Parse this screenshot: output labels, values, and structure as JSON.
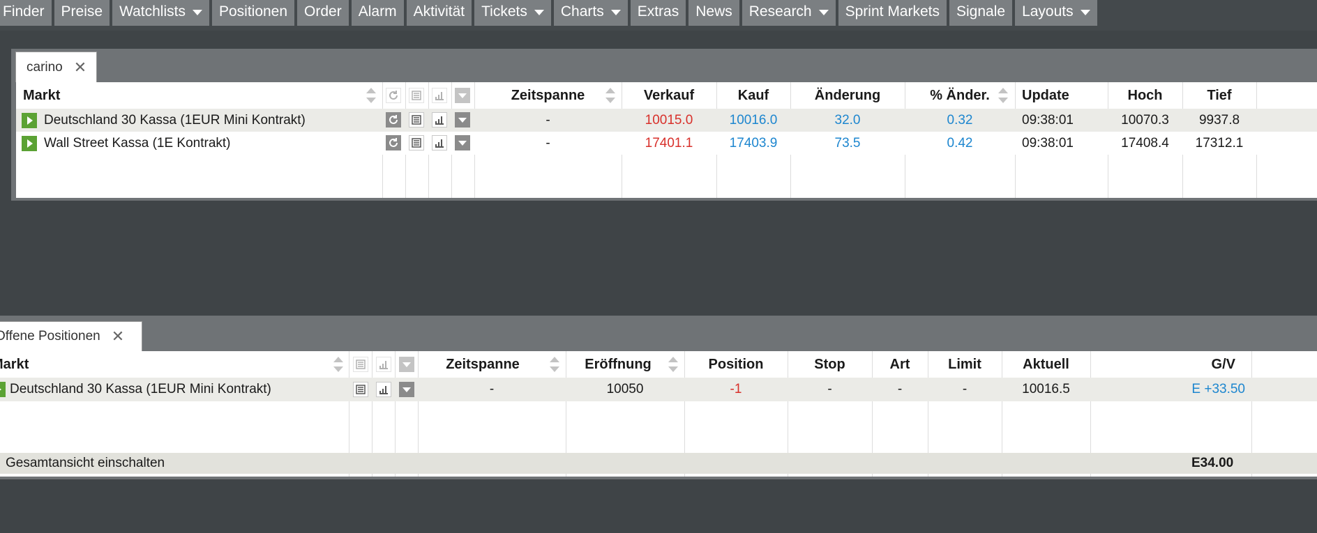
{
  "menu": [
    {
      "label": "Finder",
      "dropdown": false
    },
    {
      "label": "Preise",
      "dropdown": false
    },
    {
      "label": "Watchlists",
      "dropdown": true
    },
    {
      "label": "Positionen",
      "dropdown": false
    },
    {
      "label": "Order",
      "dropdown": false
    },
    {
      "label": "Alarm",
      "dropdown": false
    },
    {
      "label": "Aktivität",
      "dropdown": false
    },
    {
      "label": "Tickets",
      "dropdown": true
    },
    {
      "label": "Charts",
      "dropdown": true
    },
    {
      "label": "Extras",
      "dropdown": false
    },
    {
      "label": "News",
      "dropdown": false
    },
    {
      "label": "Research",
      "dropdown": true
    },
    {
      "label": "Sprint Markets",
      "dropdown": false
    },
    {
      "label": "Signale",
      "dropdown": false
    },
    {
      "label": "Layouts",
      "dropdown": true
    }
  ],
  "watchlist": {
    "tab_label": "carino",
    "close_glyph": "✕",
    "headers": {
      "markt": "Markt",
      "zeitspanne": "Zeitspanne",
      "verkauf": "Verkauf",
      "kauf": "Kauf",
      "aenderung": "Änderung",
      "pct": "% Änder.",
      "update": "Update",
      "hoch": "Hoch",
      "tief": "Tief"
    },
    "rows": [
      {
        "markt": "Deutschland 30 Kassa (1EUR Mini Kontrakt)",
        "zeitspanne": "-",
        "verkauf": "10015.0",
        "kauf": "10016.0",
        "aenderung": "32.0",
        "pct": "0.32",
        "update": "09:38:01",
        "hoch": "10070.3",
        "tief": "9937.8"
      },
      {
        "markt": "Wall Street Kassa (1E Kontrakt)",
        "zeitspanne": "-",
        "verkauf": "17401.1",
        "kauf": "17403.9",
        "aenderung": "73.5",
        "pct": "0.42",
        "update": "09:38:01",
        "hoch": "17408.4",
        "tief": "17312.1"
      }
    ]
  },
  "positions": {
    "tab_label": "Offene Positionen",
    "close_glyph": "✕",
    "headers": {
      "markt": "Markt",
      "zeitspanne": "Zeitspanne",
      "eroeffnung": "Eröffnung",
      "position": "Position",
      "stop": "Stop",
      "art": "Art",
      "limit": "Limit",
      "aktuell": "Aktuell",
      "gv": "G/V"
    },
    "rows": [
      {
        "markt": "Deutschland 30 Kassa (1EUR Mini Kontrakt)",
        "zeitspanne": "-",
        "eroeffnung": "10050",
        "position": "-1",
        "stop": "-",
        "art": "-",
        "limit": "-",
        "aktuell": "10016.5",
        "gv": "E +33.50"
      }
    ],
    "footer": {
      "label": "Gesamtansicht einschalten",
      "total": "E34.00"
    }
  },
  "colors": {
    "negative": "#d8302b",
    "positive": "#1d86cf",
    "play": "#5ba234"
  },
  "icons": [
    "refresh-icon",
    "news-icon",
    "chart-icon",
    "dropdown-icon",
    "play-icon",
    "sort-icon",
    "close-icon"
  ]
}
